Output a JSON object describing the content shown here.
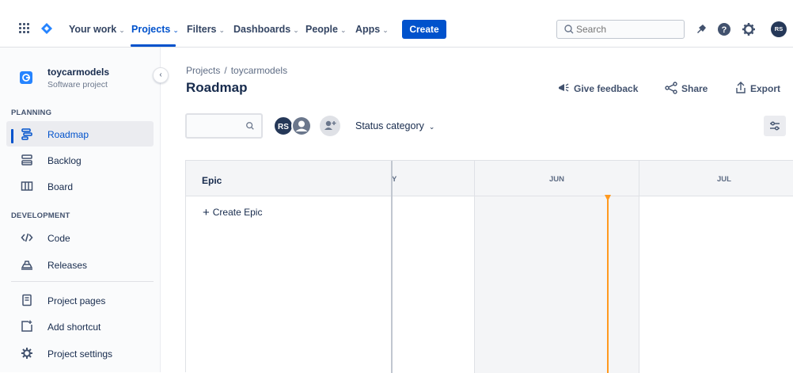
{
  "topnav": {
    "items": [
      {
        "label": "Your work"
      },
      {
        "label": "Projects"
      },
      {
        "label": "Filters"
      },
      {
        "label": "Dashboards"
      },
      {
        "label": "People"
      },
      {
        "label": "Apps"
      }
    ],
    "create_label": "Create",
    "search_placeholder": "Search",
    "avatar_initials": "RS",
    "accent_color": "#0052cc"
  },
  "sidebar": {
    "project_name": "toycarmodels",
    "project_type": "Software project",
    "sections": {
      "planning": "PLANNING",
      "development": "DEVELOPMENT"
    },
    "items": [
      {
        "label": "Roadmap",
        "icon": "roadmap-icon",
        "active": true
      },
      {
        "label": "Backlog",
        "icon": "backlog-icon"
      },
      {
        "label": "Board",
        "icon": "board-icon"
      },
      {
        "label": "Code",
        "icon": "code-icon"
      },
      {
        "label": "Releases",
        "icon": "releases-icon"
      },
      {
        "label": "Project pages",
        "icon": "page-icon"
      },
      {
        "label": "Add shortcut",
        "icon": "add-shortcut-icon"
      },
      {
        "label": "Project settings",
        "icon": "gear-icon"
      }
    ]
  },
  "main": {
    "breadcrumb": {
      "root": "Projects",
      "separator": "/",
      "project": "toycarmodels"
    },
    "title": "Roadmap",
    "actions": {
      "feedback": "Give feedback",
      "share": "Share",
      "export": "Export"
    },
    "filter": {
      "avatar_initials": "RS",
      "status_category": "Status category"
    }
  },
  "timeline": {
    "epic_header": "Epic",
    "months": [
      "Y",
      "JUN",
      "JUL"
    ],
    "create_epic": "Create Epic",
    "today_color": "#ff991f"
  }
}
